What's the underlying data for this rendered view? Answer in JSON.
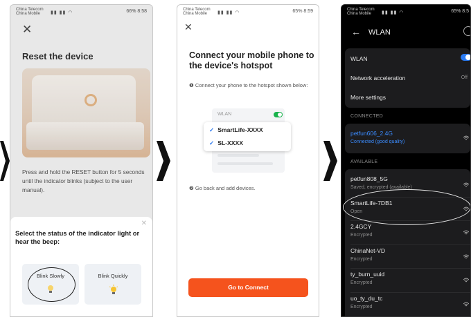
{
  "status": {
    "carrier1": "China Telecom",
    "carrier2": "China Mobile",
    "p1_right": "66% 8:58",
    "p2_right": "65% 8:59",
    "p3_right": "65% 8:5"
  },
  "screen1": {
    "title": "Reset the device",
    "description": "Press and hold the RESET button for 5 seconds until the indicator blinks (subject to the user manual).",
    "sheet_title": "Select the status of the indicator light or hear the beep:",
    "options": [
      "Blink Slowly",
      "Blink Quickly"
    ]
  },
  "screen2": {
    "title": "Connect your mobile phone to the device's hotspot",
    "step1": "Connect your phone to the hotspot shown below:",
    "wlan_label": "WLAN",
    "networks": [
      "SmartLife-XXXX",
      "SL-XXXX"
    ],
    "step2": "Go back and add devices.",
    "button": "Go to Connect"
  },
  "screen3": {
    "title": "WLAN",
    "settings": [
      {
        "label": "WLAN",
        "value": ""
      },
      {
        "label": "Network acceleration",
        "value": "Off"
      },
      {
        "label": "More settings",
        "value": ""
      }
    ],
    "connected_header": "CONNECTED",
    "connected": {
      "name": "petfun606_2.4G",
      "status": "Connected (good quality)"
    },
    "available_header": "AVAILABLE",
    "available": [
      {
        "name": "petfun808_5G",
        "status": "Saved, encrypted (available)"
      },
      {
        "name": "SmartLife-7DB1",
        "status": "Open"
      },
      {
        "name": "2.4GCY",
        "status": "Encrypted"
      },
      {
        "name": "ChinaNet-VD",
        "status": "Encrypted"
      },
      {
        "name": "ty_burn_uuid",
        "status": "Encrypted"
      },
      {
        "name": "uo_ty_du_tc",
        "status": "Encrypted"
      }
    ]
  },
  "colors": {
    "accent_orange": "#f5531d",
    "toggle_green": "#19b34c",
    "wifi_blue": "#2a7bf4",
    "arrow": "#111111"
  }
}
